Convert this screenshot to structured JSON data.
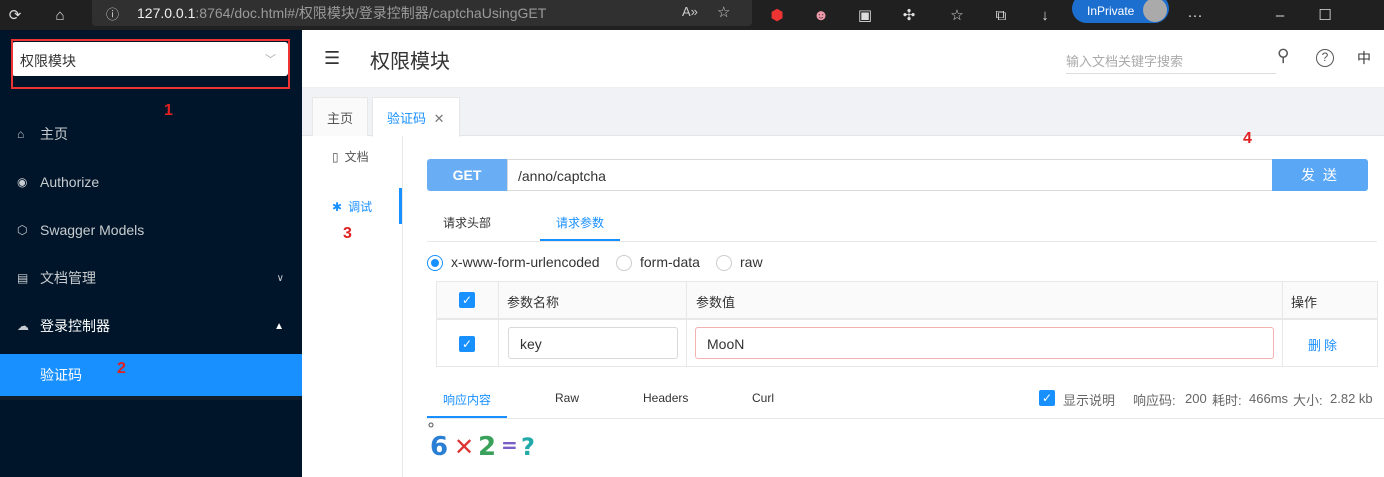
{
  "browser": {
    "url_host": "127.0.0.1",
    "url_rest": ":8764/doc.html#/权限模块/登录控制器/captchaUsingGET",
    "inprivate_label": "InPrivate"
  },
  "sidebar": {
    "group_select": "权限模块",
    "items": [
      {
        "label": "主页",
        "icon": "home-icon"
      },
      {
        "label": "Authorize",
        "icon": "lock-icon"
      },
      {
        "label": "Swagger Models",
        "icon": "code-sandbox-icon"
      },
      {
        "label": "文档管理",
        "icon": "file-search-icon"
      },
      {
        "label": "登录控制器",
        "icon": "cloud-icon"
      }
    ],
    "active_subitem": "验证码"
  },
  "annotations": [
    "1",
    "2",
    "3",
    "4"
  ],
  "header": {
    "title": "权限模块",
    "search_placeholder": "输入文档关键字搜索",
    "lang": "中"
  },
  "tabs": [
    {
      "label": "主页"
    },
    {
      "label": "验证码"
    }
  ],
  "left_nav": [
    {
      "label": "文档"
    },
    {
      "label": "调试"
    }
  ],
  "request": {
    "method": "GET",
    "path": "/anno/captcha",
    "send_label": "发 送"
  },
  "req_tabs": [
    "请求头部",
    "请求参数"
  ],
  "content_types": [
    "x-www-form-urlencoded",
    "form-data",
    "raw"
  ],
  "params_table": {
    "headers": [
      "参数名称",
      "参数值",
      "操作"
    ],
    "rows": [
      {
        "name": "key",
        "value": "MooN",
        "action": "删除"
      }
    ]
  },
  "response": {
    "tabs": [
      "响应内容",
      "Raw",
      "Headers",
      "Curl"
    ],
    "show_desc_label": "显示说明",
    "code_label": "响应码:",
    "code": "200",
    "time_label": "耗时:",
    "time": "466ms",
    "size_label": "大小:",
    "size": "2.82 kb"
  },
  "colors": {
    "accent": "#1890ff",
    "sidebar_bg": "#001529",
    "success": "#3cb46e",
    "annotation": "#e02020"
  }
}
